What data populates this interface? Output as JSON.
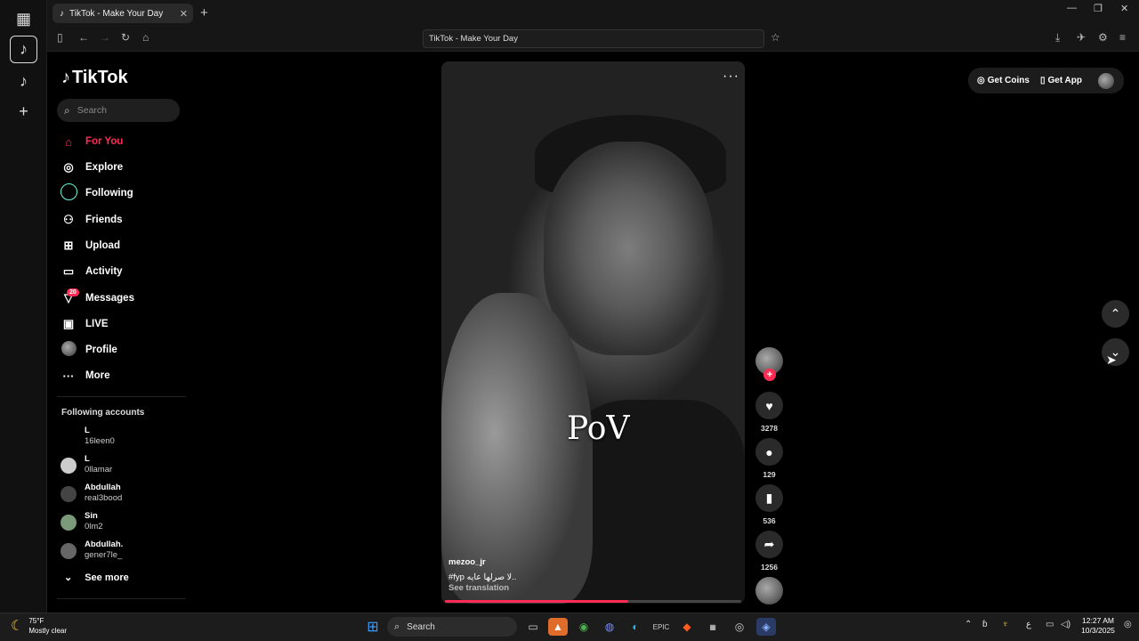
{
  "browser": {
    "tab_title": "TikTok - Make Your Day",
    "url_text": "TikTok - Make Your Day",
    "new_tab": "+",
    "close_tab": "✕"
  },
  "sidebar": {
    "logo": "TikTok",
    "search_placeholder": "Search",
    "nav": [
      {
        "label": "For You",
        "icon": "home-icon",
        "active": true
      },
      {
        "label": "Explore",
        "icon": "compass-icon"
      },
      {
        "label": "Following",
        "icon": "following-icon"
      },
      {
        "label": "Friends",
        "icon": "friends-icon"
      },
      {
        "label": "Upload",
        "icon": "upload-icon"
      },
      {
        "label": "Activity",
        "icon": "activity-icon"
      },
      {
        "label": "Messages",
        "icon": "messages-icon"
      },
      {
        "label": "LIVE",
        "icon": "live-icon"
      },
      {
        "label": "Profile",
        "icon": "profile-avatar"
      },
      {
        "label": "More",
        "icon": "more-icon"
      }
    ],
    "messages_badge": "20",
    "following_title": "Following accounts",
    "accounts": [
      {
        "name": "L",
        "username": "16leen0"
      },
      {
        "name": "L",
        "username": "0llamar"
      },
      {
        "name": "Abdullah",
        "username": "real3bood"
      },
      {
        "name": "Sin",
        "username": "0lm2"
      },
      {
        "name": "Abdullah.",
        "username": "gener7le_"
      }
    ],
    "see_more": "See more"
  },
  "video": {
    "overlay_text": "PoV",
    "username": "mezoo_jr",
    "caption": "#fyp لا صرلها عايه..",
    "see_translation": "See translation",
    "progress": 0.62
  },
  "actions": {
    "likes": "3278",
    "comments": "129",
    "saves": "536",
    "shares": "1256"
  },
  "topbar": {
    "get_coins": "Get Coins",
    "get_app": "Get App"
  },
  "taskbar": {
    "temp": "75°F",
    "weather": "Mostly clear",
    "search": "Search",
    "time": "12:27 AM",
    "date": "10/3/2025",
    "lang": "ع"
  }
}
